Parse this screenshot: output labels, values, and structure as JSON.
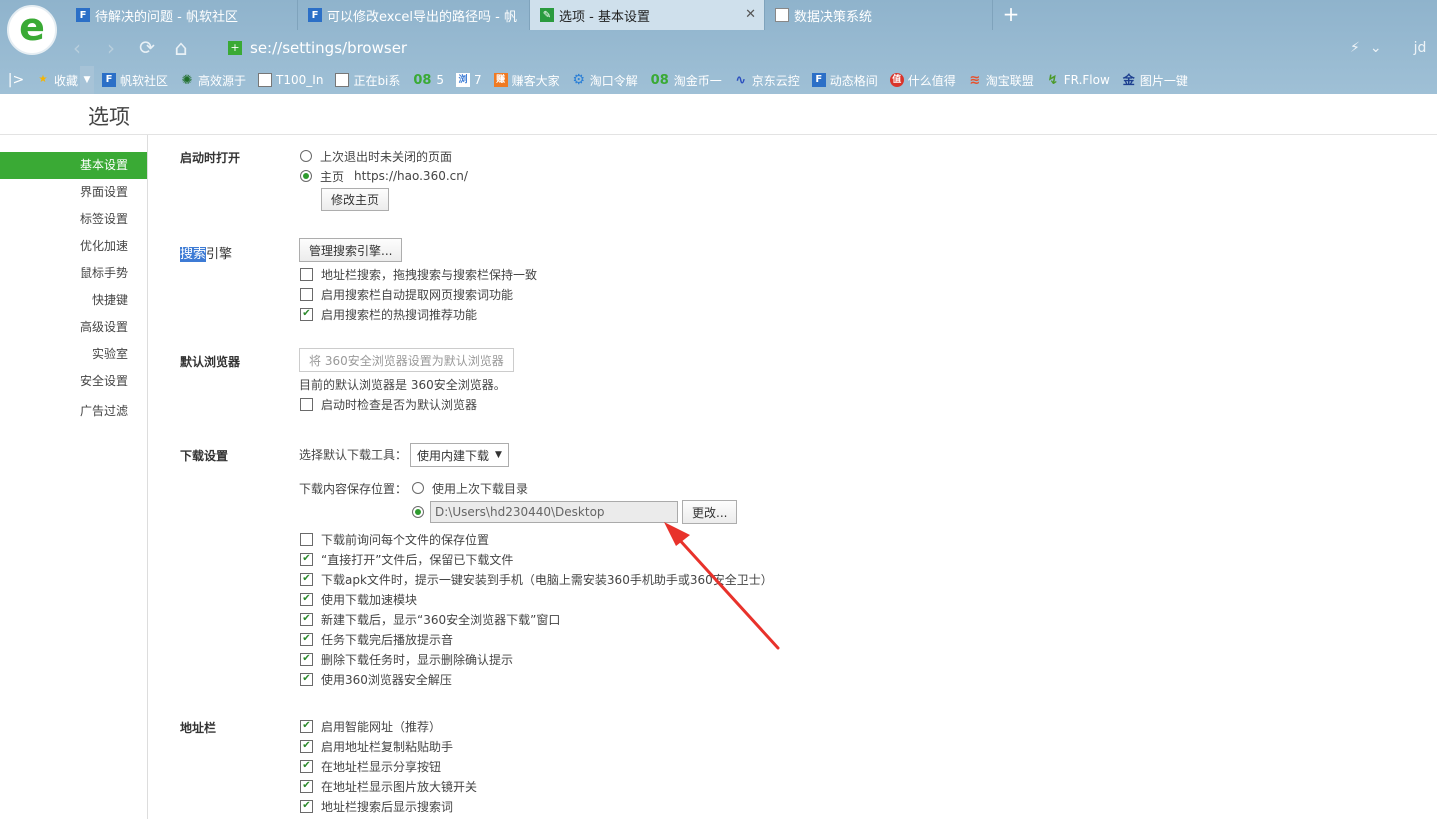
{
  "browser": {
    "logo_letter": "e",
    "tabs": [
      {
        "label": "待解决的问题 - 帆软社区",
        "icon": "fanruan-icon"
      },
      {
        "label": "可以修改excel导出的路径吗 - 帆",
        "icon": "fanruan-icon"
      },
      {
        "label": "选项 - 基本设置",
        "icon": "wrench-icon",
        "close": "✕"
      },
      {
        "label": "数据决策系统",
        "icon": "document-icon"
      }
    ],
    "new_tab": "+",
    "back": "‹",
    "forward": "›",
    "refresh": "⟳",
    "home": "⌂",
    "address": "se://settings/browser",
    "lightning": "⚡",
    "dropdown": "⌄",
    "user": "jd",
    "bookmark_toggle": "|>",
    "bookmarks": [
      {
        "label": "收藏",
        "icon": "star-icon"
      },
      {
        "label": "帆软社区",
        "icon": "fanruan-icon"
      },
      {
        "label": "高效源于",
        "icon": "gear-icon"
      },
      {
        "label": "T100_In",
        "icon": "document-icon"
      },
      {
        "label": "正在bi系",
        "icon": "document-icon"
      },
      {
        "label": "5",
        "icon": "o8-icon"
      },
      {
        "label": "7",
        "icon": "b-icon"
      },
      {
        "label": "赚客大家",
        "icon": "zhuan-icon"
      },
      {
        "label": "淘口令解",
        "icon": "gear-icon"
      },
      {
        "label": "淘金币一",
        "icon": "o8-icon"
      },
      {
        "label": "京东云控",
        "icon": "jd-icon"
      },
      {
        "label": "动态格间",
        "icon": "fanruan-icon"
      },
      {
        "label": "什么值得",
        "icon": "zhi-icon"
      },
      {
        "label": "淘宝联盟",
        "icon": "taobao-icon"
      },
      {
        "label": "FR.Flow",
        "icon": "flow-icon"
      },
      {
        "label": "图片一键",
        "icon": "jin-icon"
      }
    ]
  },
  "page": {
    "title": "选项",
    "sidebar": [
      {
        "label": "基本设置",
        "active": true
      },
      {
        "label": "界面设置"
      },
      {
        "label": "标签设置"
      },
      {
        "label": "优化加速"
      },
      {
        "label": "鼠标手势"
      },
      {
        "label": "快捷键"
      },
      {
        "label": "高级设置"
      },
      {
        "label": "实验室"
      },
      {
        "label": "安全设置"
      },
      {
        "label": "广告过滤"
      }
    ],
    "startup": {
      "title": "启动时打开",
      "opt_last": "上次退出时未关闭的页面",
      "opt_home": "主页",
      "home_url": "https://hao.360.cn/",
      "edit_home": "修改主页"
    },
    "search": {
      "title_highlight": "搜索",
      "title_rest": "引擎",
      "manage": "管理搜索引擎...",
      "items": [
        {
          "label": "地址栏搜索，拖拽搜索与搜索栏保持一致",
          "checked": false
        },
        {
          "label": "启用搜索栏自动提取网页搜索词功能",
          "checked": false
        },
        {
          "label": "启用搜索栏的热搜词推荐功能",
          "checked": true
        }
      ]
    },
    "default_browser": {
      "title": "默认浏览器",
      "set_btn": "将 360安全浏览器设置为默认浏览器",
      "status": "目前的默认浏览器是 360安全浏览器。",
      "check_label": "启动时检查是否为默认浏览器"
    },
    "download": {
      "title": "下载设置",
      "tool_label": "选择默认下载工具：",
      "tool_value": "使用内建下载",
      "location_label": "下载内容保存位置：",
      "opt_last_dir": "使用上次下载目录",
      "path": "D:\\Users\\hd230440\\Desktop",
      "change_btn": "更改...",
      "items": [
        {
          "label": "下载前询问每个文件的保存位置",
          "checked": false
        },
        {
          "label": "“直接打开”文件后，保留已下载文件",
          "checked": true
        },
        {
          "label": "下载apk文件时，提示一键安装到手机（电脑上需安装360手机助手或360安全卫士）",
          "checked": true
        },
        {
          "label": "使用下载加速模块",
          "checked": true
        },
        {
          "label": "新建下载后，显示“360安全浏览器下载”窗口",
          "checked": true
        },
        {
          "label": "任务下载完后播放提示音",
          "checked": true
        },
        {
          "label": "删除下载任务时，显示删除确认提示",
          "checked": true
        },
        {
          "label": "使用360浏览器安全解压",
          "checked": true
        }
      ]
    },
    "addressbar": {
      "title": "地址栏",
      "items": [
        {
          "label": "启用智能网址（推荐）",
          "checked": true
        },
        {
          "label": "启用地址栏复制粘贴助手",
          "checked": true
        },
        {
          "label": "在地址栏显示分享按钮",
          "checked": true
        },
        {
          "label": "在地址栏显示图片放大镜开关",
          "checked": true
        },
        {
          "label": "地址栏搜索后显示搜索词",
          "checked": true
        }
      ]
    },
    "check_mark": "✔",
    "select_arrow": "▼",
    "annotation_color": "#e8322b"
  }
}
